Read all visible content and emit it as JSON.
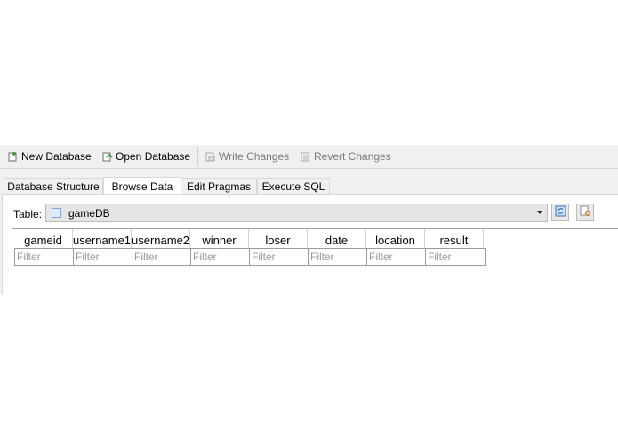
{
  "toolbar": {
    "new_database": "New Database",
    "open_database": "Open Database",
    "write_changes": "Write Changes",
    "revert_changes": "Revert Changes"
  },
  "tabs": [
    {
      "label": "Database Structure",
      "active": false
    },
    {
      "label": "Browse Data",
      "active": true
    },
    {
      "label": "Edit Pragmas",
      "active": false
    },
    {
      "label": "Execute SQL",
      "active": false
    }
  ],
  "browse": {
    "table_label": "Table:",
    "selected_table": "gameDB",
    "columns": [
      "gameid",
      "username1",
      "username2",
      "winner",
      "loser",
      "date",
      "location",
      "result"
    ],
    "filter_placeholder": "Filter"
  },
  "colors": {
    "window_bg": "#f0f0f0",
    "disabled_text": "#7a7a7a",
    "accent_blue": "#2f6fbf",
    "accent_orange": "#e06a1a"
  },
  "icons": [
    "new-database-icon",
    "open-database-icon",
    "write-changes-icon",
    "revert-changes-icon",
    "table-icon",
    "refresh-icon",
    "clear-filters-icon"
  ]
}
